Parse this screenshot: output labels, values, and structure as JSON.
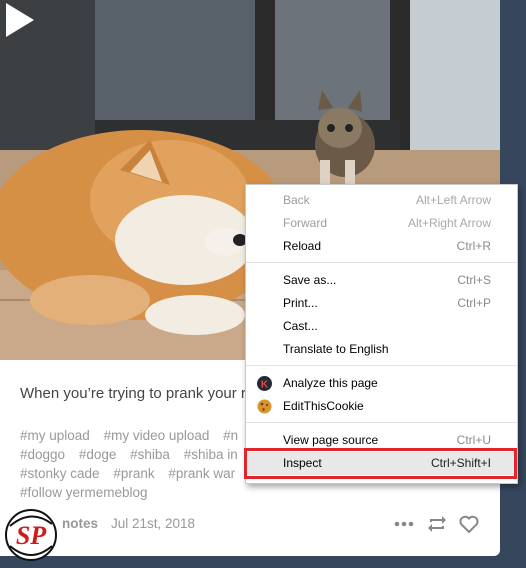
{
  "post": {
    "caption": "When you’re trying to prank your r",
    "tags": [
      "#my upload",
      "#my video upload",
      "#n",
      "#doggo",
      "#doge",
      "#shiba",
      "#shiba in",
      "#stonky cade",
      "#prank",
      "#prank war",
      "#follow yermemeblog"
    ],
    "notes_label": "notes",
    "date": "Jul 21st, 2018"
  },
  "context_menu": {
    "items": [
      {
        "label": "Back",
        "shortcut": "Alt+Left Arrow",
        "enabled": false
      },
      {
        "label": "Forward",
        "shortcut": "Alt+Right Arrow",
        "enabled": false
      },
      {
        "label": "Reload",
        "shortcut": "Ctrl+R",
        "enabled": true
      },
      {
        "label": "Save as...",
        "shortcut": "Ctrl+S",
        "enabled": true
      },
      {
        "label": "Print...",
        "shortcut": "Ctrl+P",
        "enabled": true
      },
      {
        "label": "Cast...",
        "shortcut": "",
        "enabled": true
      },
      {
        "label": "Translate to English",
        "shortcut": "",
        "enabled": true
      },
      {
        "label": "Analyze this page",
        "shortcut": "",
        "enabled": true,
        "icon": "k-extension-icon"
      },
      {
        "label": "EditThisCookie",
        "shortcut": "",
        "enabled": true,
        "icon": "cookie-icon"
      },
      {
        "label": "View page source",
        "shortcut": "Ctrl+U",
        "enabled": true
      },
      {
        "label": "Inspect",
        "shortcut": "Ctrl+Shift+I",
        "enabled": true,
        "highlighted": true
      }
    ]
  },
  "watermark": {
    "text": "SP"
  },
  "colors": {
    "dashboard_bg": "#36465d",
    "highlight_box": "#e0262c",
    "tag_text": "#999999"
  }
}
